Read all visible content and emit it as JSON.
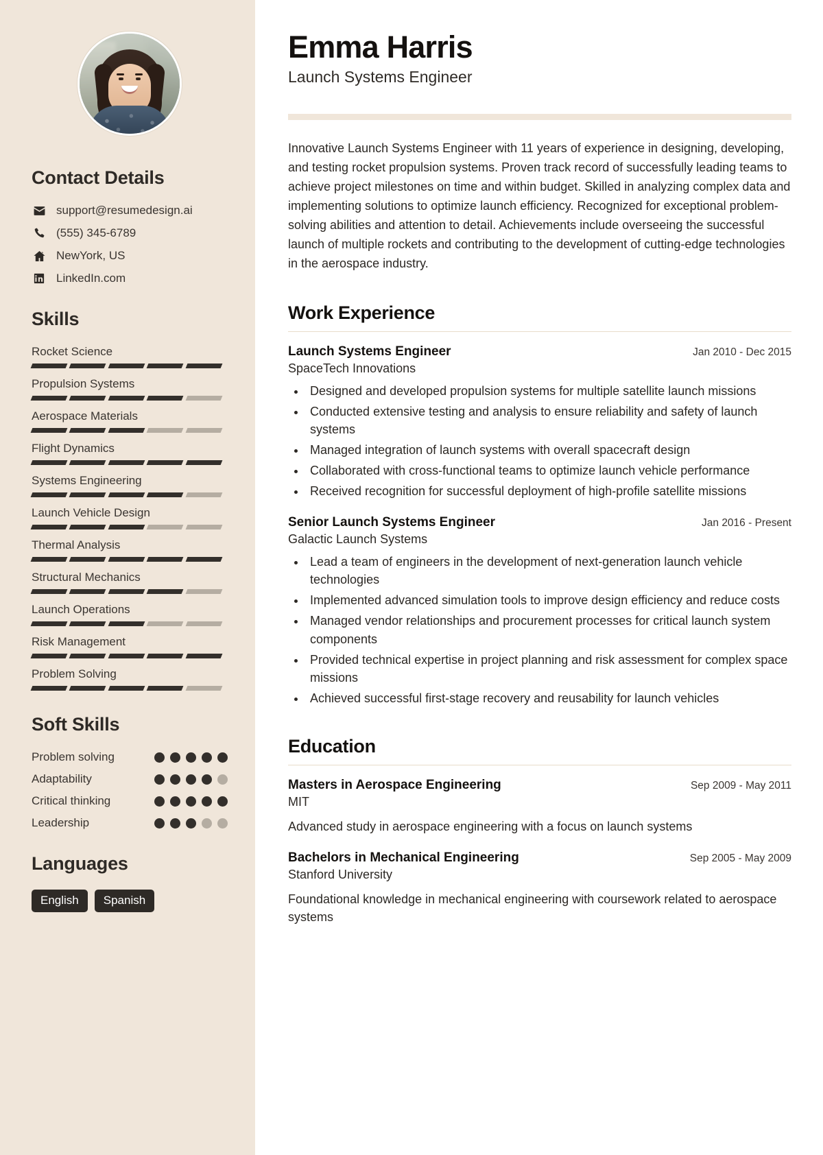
{
  "sidebar": {
    "avatar_alt": "profile-photo",
    "contact": {
      "heading": "Contact Details",
      "items": [
        {
          "icon": "envelope-icon",
          "value": "support@resumedesign.ai"
        },
        {
          "icon": "phone-icon",
          "value": "(555) 345-6789"
        },
        {
          "icon": "home-icon",
          "value": "NewYork, US"
        },
        {
          "icon": "linkedin-icon",
          "value": "LinkedIn.com"
        }
      ]
    },
    "skills": {
      "heading": "Skills",
      "max": 5,
      "items": [
        {
          "name": "Rocket Science",
          "level": 5
        },
        {
          "name": "Propulsion Systems",
          "level": 4
        },
        {
          "name": "Aerospace Materials",
          "level": 3
        },
        {
          "name": "Flight Dynamics",
          "level": 5
        },
        {
          "name": "Systems Engineering",
          "level": 4
        },
        {
          "name": "Launch Vehicle Design",
          "level": 3
        },
        {
          "name": "Thermal Analysis",
          "level": 5
        },
        {
          "name": "Structural Mechanics",
          "level": 4
        },
        {
          "name": "Launch Operations",
          "level": 3
        },
        {
          "name": "Risk Management",
          "level": 5
        },
        {
          "name": "Problem Solving",
          "level": 4
        }
      ]
    },
    "soft_skills": {
      "heading": "Soft Skills",
      "max": 5,
      "items": [
        {
          "name": "Problem solving",
          "level": 5
        },
        {
          "name": "Adaptability",
          "level": 4
        },
        {
          "name": "Critical thinking",
          "level": 5
        },
        {
          "name": "Leadership",
          "level": 3
        }
      ]
    },
    "languages": {
      "heading": "Languages",
      "items": [
        "English",
        "Spanish"
      ]
    }
  },
  "main": {
    "name": "Emma Harris",
    "role": "Launch Systems Engineer",
    "summary": "Innovative Launch Systems Engineer with 11 years of experience in designing, developing, and testing rocket propulsion systems. Proven track record of successfully leading teams to achieve project milestones on time and within budget. Skilled in analyzing complex data and implementing solutions to optimize launch efficiency. Recognized for exceptional problem-solving abilities and attention to detail. Achievements include overseeing the successful launch of multiple rockets and contributing to the development of cutting-edge technologies in the aerospace industry.",
    "work": {
      "heading": "Work Experience",
      "entries": [
        {
          "title": "Launch Systems Engineer",
          "date": "Jan 2010 - Dec 2015",
          "org": "SpaceTech Innovations",
          "bullets": [
            "Designed and developed propulsion systems for multiple satellite launch missions",
            "Conducted extensive testing and analysis to ensure reliability and safety of launch systems",
            "Managed integration of launch systems with overall spacecraft design",
            "Collaborated with cross-functional teams to optimize launch vehicle performance",
            "Received recognition for successful deployment of high-profile satellite missions"
          ]
        },
        {
          "title": "Senior Launch Systems Engineer",
          "date": "Jan 2016 - Present",
          "org": "Galactic Launch Systems",
          "bullets": [
            "Lead a team of engineers in the development of next-generation launch vehicle technologies",
            "Implemented advanced simulation tools to improve design efficiency and reduce costs",
            "Managed vendor relationships and procurement processes for critical launch system components",
            "Provided technical expertise in project planning and risk assessment for complex space missions",
            "Achieved successful first-stage recovery and reusability for launch vehicles"
          ]
        }
      ]
    },
    "education": {
      "heading": "Education",
      "entries": [
        {
          "title": "Masters in Aerospace Engineering",
          "date": "Sep 2009 - May 2011",
          "org": "MIT",
          "description": "Advanced study in aerospace engineering with a focus on launch systems"
        },
        {
          "title": "Bachelors in Mechanical Engineering",
          "date": "Sep 2005 - May 2009",
          "org": "Stanford University",
          "description": "Foundational knowledge in mechanical engineering with coursework related to aerospace systems"
        }
      ]
    }
  },
  "colors": {
    "sidebar_bg": "#f0e6da",
    "accent_rule": "#f0e6da",
    "ink": "#14110f",
    "bar_on": "#332f2b",
    "bar_off": "#b5ada2"
  }
}
